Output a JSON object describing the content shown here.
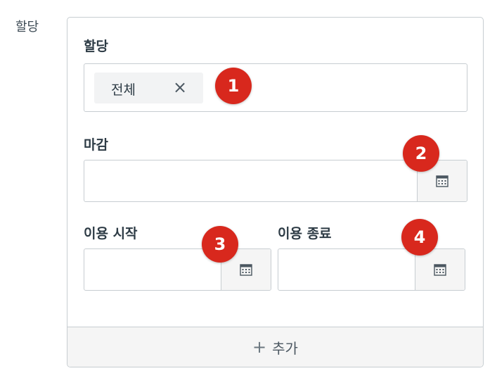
{
  "side_label": "할당",
  "card": {
    "assign_label": "할당",
    "assign_tag": "전체",
    "due_label": "마감",
    "available_from_label": "이용 시작",
    "until_label": "이용 종료",
    "add_label": "추가"
  },
  "badges": [
    "1",
    "2",
    "3",
    "4"
  ],
  "icons": {
    "tag_remove": "close-icon",
    "calendar": "calendar-icon",
    "add": "plus-icon"
  },
  "colors": {
    "badge": "#d8281d",
    "border": "#c7cdd1",
    "text": "#2d3b45"
  }
}
